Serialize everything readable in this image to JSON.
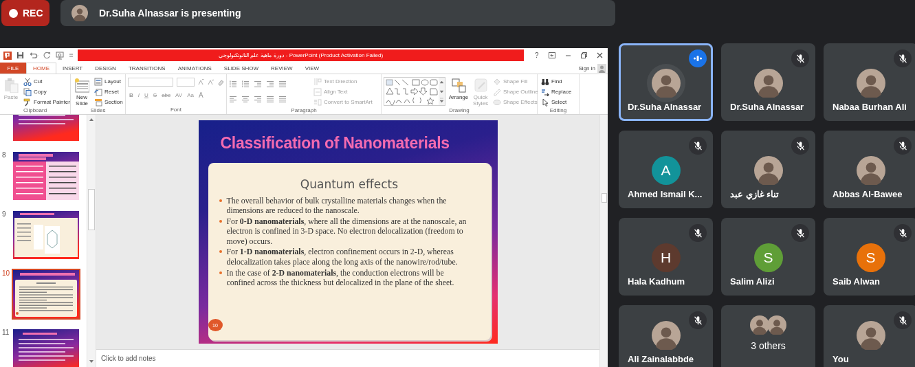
{
  "recording": {
    "label": "REC"
  },
  "presenter_banner": {
    "text": "Dr.Suha Alnassar is presenting"
  },
  "powerpoint": {
    "title": "دورة ماهية علم النانوتكنولوجي - PowerPoint (Product Activation Failed)",
    "help": "?",
    "sign_in": "Sign in",
    "tabs": [
      {
        "label": "FILE",
        "kind": "file",
        "selected": false
      },
      {
        "label": "HOME",
        "kind": "tab",
        "selected": true
      },
      {
        "label": "INSERT",
        "kind": "tab",
        "selected": false
      },
      {
        "label": "DESIGN",
        "kind": "tab",
        "selected": false
      },
      {
        "label": "TRANSITIONS",
        "kind": "tab",
        "selected": false
      },
      {
        "label": "ANIMATIONS",
        "kind": "tab",
        "selected": false
      },
      {
        "label": "SLIDE SHOW",
        "kind": "tab",
        "selected": false
      },
      {
        "label": "REVIEW",
        "kind": "tab",
        "selected": false
      },
      {
        "label": "VIEW",
        "kind": "tab",
        "selected": false
      }
    ],
    "ribbon": [
      {
        "title": "Clipboard",
        "kind": "clipboard",
        "items": [
          {
            "label": "Paste",
            "disabled": true
          },
          {
            "label": "Cut",
            "disabled": false
          },
          {
            "label": "Copy",
            "disabled": false
          },
          {
            "label": "Format Painter",
            "disabled": false
          }
        ]
      },
      {
        "title": "Slides",
        "kind": "slides",
        "items": [
          {
            "label": "New Slide",
            "disabled": false
          },
          {
            "label": "Layout",
            "disabled": false
          },
          {
            "label": "Reset",
            "disabled": false
          },
          {
            "label": "Section",
            "disabled": false
          }
        ]
      },
      {
        "title": "Font",
        "kind": "font",
        "items": [
          {
            "label": "B",
            "disabled": true
          },
          {
            "label": "I",
            "disabled": true
          },
          {
            "label": "U",
            "disabled": true
          },
          {
            "label": "S",
            "disabled": true
          },
          {
            "label": "abc",
            "disabled": true
          },
          {
            "label": "AV",
            "disabled": true
          },
          {
            "label": "Aa",
            "disabled": true
          },
          {
            "label": "A",
            "disabled": true
          }
        ]
      },
      {
        "title": "Paragraph",
        "kind": "paragraph",
        "items": [
          {
            "label": "Text Direction",
            "disabled": true
          },
          {
            "label": "Align Text",
            "disabled": true
          },
          {
            "label": "Convert to SmartArt",
            "disabled": true
          }
        ]
      },
      {
        "title": "Drawing",
        "kind": "drawing",
        "items": [
          {
            "label": "Arrange",
            "disabled": false
          },
          {
            "label": "Quick Styles",
            "disabled": true
          },
          {
            "label": "Shape Fill",
            "disabled": true
          },
          {
            "label": "Shape Outline",
            "disabled": true
          },
          {
            "label": "Shape Effects",
            "disabled": true
          }
        ]
      },
      {
        "title": "Editing",
        "kind": "editing",
        "items": [
          {
            "label": "Find",
            "disabled": false
          },
          {
            "label": "Replace",
            "disabled": false
          },
          {
            "label": "Select",
            "disabled": false
          }
        ]
      }
    ],
    "thumbnails": [
      {
        "kind": "text",
        "selected": false
      },
      {
        "number": "8",
        "kind": "table",
        "selected": false
      },
      {
        "number": "9",
        "kind": "diagram",
        "selected": false
      },
      {
        "number": "10",
        "kind": "bullets",
        "selected": true
      },
      {
        "number": "11",
        "kind": "text",
        "selected": false
      }
    ],
    "slide": {
      "title": "Classification of Nanomaterials",
      "heading": "Quantum effects",
      "bullets": [
        "The overall behavior of bulk crystalline materials changes when the dimensions are reduced to the nanoscale.",
        "For **0-D nanomaterials**, where all the dimensions are at the nanoscale, an electron is confined in 3-D space. No electron delocalization (freedom to move) occurs.",
        "For **1-D nanomaterials**, electron confinement occurs in 2-D, whereas delocalization takes place along the long axis of the nanowire/rod/tube.",
        "In the case of **2-D nanomaterials**, the conduction electrons will be confined across the thickness but delocalized in the plane of the sheet."
      ],
      "page_number": "10"
    },
    "notes": {
      "placeholder": "Click to add notes"
    }
  },
  "participants": [
    {
      "name": "Dr.Suha Alnassar",
      "kind": "photo",
      "muted": false,
      "speaking": true,
      "selected": true
    },
    {
      "name": "Dr.Suha Alnassar",
      "kind": "photo",
      "muted": true,
      "speaking": false,
      "selected": false
    },
    {
      "name": "Nabaa Burhan Ali",
      "kind": "photo",
      "muted": true,
      "speaking": false,
      "selected": false
    },
    {
      "name": "Ahmed Ismail K...",
      "kind": "initial",
      "initial": "A",
      "color": "#12939a",
      "muted": true,
      "speaking": false,
      "selected": false
    },
    {
      "name": "تناء غازي عبد",
      "kind": "photo",
      "muted": true,
      "speaking": false,
      "selected": false
    },
    {
      "name": "Abbas Al-Bawee",
      "kind": "photo",
      "muted": true,
      "speaking": false,
      "selected": false
    },
    {
      "name": "Hala Kadhum",
      "kind": "initial",
      "initial": "H",
      "color": "#5d3a2e",
      "muted": true,
      "speaking": false,
      "selected": false
    },
    {
      "name": "Salim Alizi",
      "kind": "initial",
      "initial": "S",
      "color": "#5f9e37",
      "muted": true,
      "speaking": false,
      "selected": false
    },
    {
      "name": "Saib Alwan",
      "kind": "initial",
      "initial": "S",
      "color": "#e8710a",
      "muted": true,
      "speaking": false,
      "selected": false
    },
    {
      "name": "Ali Zainalabbde",
      "kind": "photo",
      "muted": true,
      "speaking": false,
      "selected": false
    },
    {
      "name": "3 others",
      "kind": "group",
      "muted": false,
      "speaking": false,
      "selected": false
    },
    {
      "name": "You",
      "kind": "photo",
      "muted": true,
      "speaking": false,
      "selected": false
    }
  ]
}
